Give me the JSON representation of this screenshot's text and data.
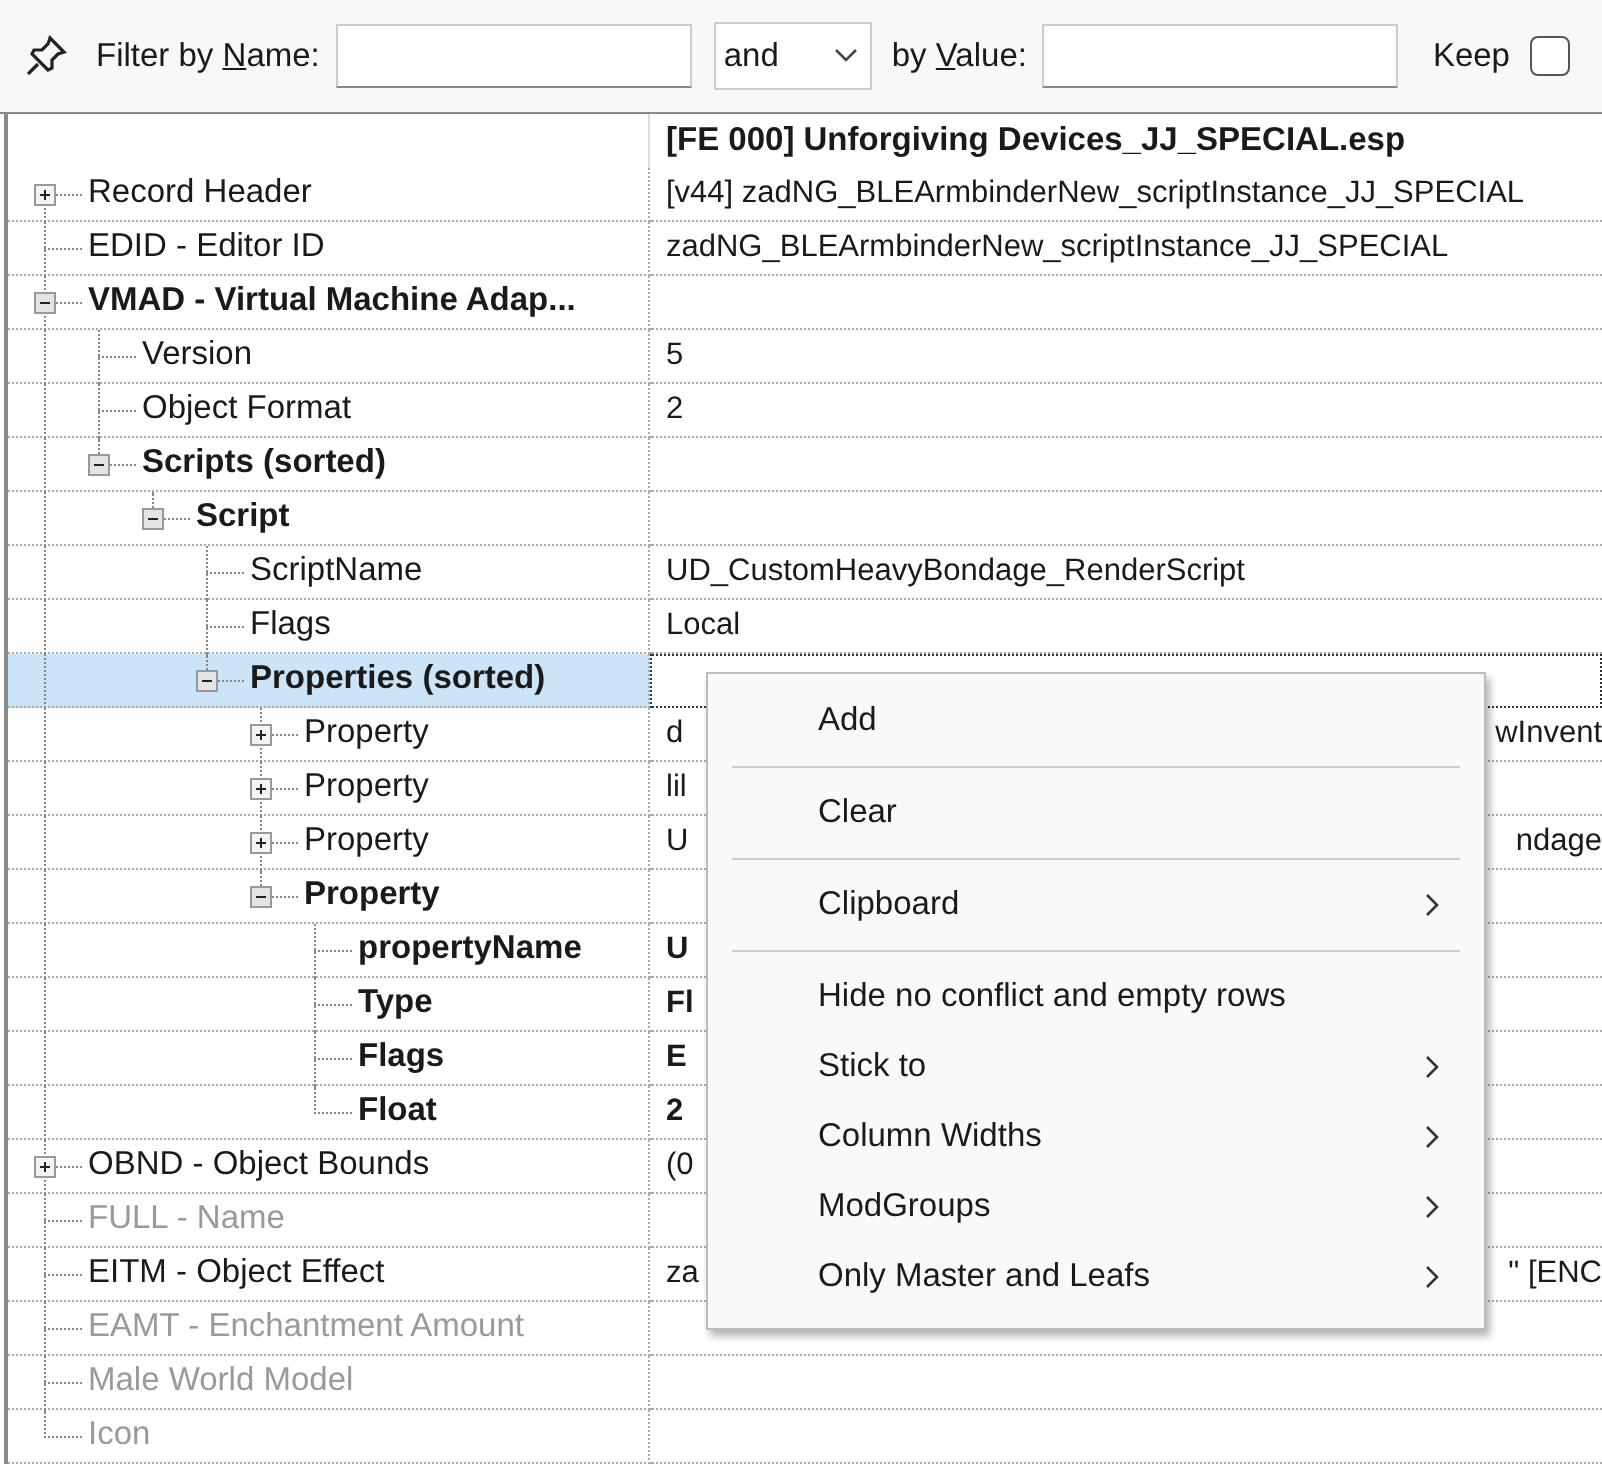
{
  "filter_bar": {
    "name_label": {
      "before": "Filter by ",
      "key": "N",
      "after": "ame:"
    },
    "operator": "and",
    "value_label": {
      "before": "by ",
      "key": "V",
      "after": "alue:"
    },
    "keep_label": "Keep",
    "keep_checked": false
  },
  "table": {
    "header": "[FE 000] Unforgiving Devices_JJ_SPECIAL.esp",
    "tree": [
      {
        "label": "Record Header",
        "value": "[v44] zadNG_BLEArmbinderNew_scriptInstance_JJ_SPECIAL",
        "kind": "branch",
        "expanded": false,
        "bold": false,
        "empty": false,
        "selected": false
      },
      {
        "label": "EDID - Editor ID",
        "value": "zadNG_BLEArmbinderNew_scriptInstance_JJ_SPECIAL",
        "kind": "leaf",
        "bold": false,
        "empty": false,
        "selected": false
      },
      {
        "label": "VMAD - Virtual Machine Adap...",
        "kind": "branch",
        "expanded": true,
        "bold": true,
        "empty": false,
        "selected": false,
        "children": [
          {
            "label": "Version",
            "value": "5",
            "kind": "leaf",
            "bold": false,
            "empty": false,
            "selected": false
          },
          {
            "label": "Object Format",
            "value": "2",
            "kind": "leaf",
            "bold": false,
            "empty": false,
            "selected": false
          },
          {
            "label": "Scripts (sorted)",
            "kind": "branch",
            "expanded": true,
            "bold": true,
            "empty": false,
            "selected": false,
            "children": [
              {
                "label": "Script",
                "kind": "branch",
                "expanded": true,
                "bold": true,
                "empty": false,
                "selected": false,
                "children": [
                  {
                    "label": "ScriptName",
                    "value": "UD_CustomHeavyBondage_RenderScript",
                    "kind": "leaf",
                    "bold": false,
                    "empty": false,
                    "selected": false
                  },
                  {
                    "label": "Flags",
                    "value": "Local",
                    "kind": "leaf",
                    "bold": false,
                    "empty": false,
                    "selected": false
                  },
                  {
                    "label": "Properties (sorted)",
                    "kind": "branch",
                    "expanded": true,
                    "bold": true,
                    "empty": false,
                    "selected": true,
                    "children": [
                      {
                        "label": "Property",
                        "value": "d",
                        "value_tail": "wInvent",
                        "kind": "branch",
                        "expanded": false,
                        "bold": false,
                        "empty": false,
                        "selected": false
                      },
                      {
                        "label": "Property",
                        "value": "lil",
                        "kind": "branch",
                        "expanded": false,
                        "bold": false,
                        "empty": false,
                        "selected": false
                      },
                      {
                        "label": "Property",
                        "value": "U",
                        "value_tail": "ndage",
                        "kind": "branch",
                        "expanded": false,
                        "bold": false,
                        "empty": false,
                        "selected": false
                      },
                      {
                        "label": "Property",
                        "kind": "branch",
                        "expanded": true,
                        "bold": true,
                        "empty": false,
                        "selected": false,
                        "children": [
                          {
                            "label": "propertyName",
                            "value": "U",
                            "kind": "leaf",
                            "bold": true,
                            "empty": false,
                            "selected": false
                          },
                          {
                            "label": "Type",
                            "value": "Fl",
                            "kind": "leaf",
                            "bold": true,
                            "empty": false,
                            "selected": false
                          },
                          {
                            "label": "Flags",
                            "value": "E",
                            "kind": "leaf",
                            "bold": true,
                            "empty": false,
                            "selected": false
                          },
                          {
                            "label": "Float",
                            "value": "2",
                            "kind": "leaf",
                            "bold": true,
                            "empty": false,
                            "selected": false
                          }
                        ]
                      }
                    ]
                  }
                ]
              }
            ]
          }
        ]
      },
      {
        "label": "OBND - Object Bounds",
        "value": "(0",
        "kind": "branch",
        "expanded": false,
        "bold": false,
        "empty": false,
        "selected": false
      },
      {
        "label": "FULL - Name",
        "kind": "leaf",
        "bold": false,
        "empty": true,
        "selected": false
      },
      {
        "label": "EITM - Object Effect",
        "value": "za",
        "value_tail": "\" [ENC",
        "kind": "leaf",
        "bold": false,
        "empty": false,
        "selected": false
      },
      {
        "label": "EAMT - Enchantment Amount",
        "kind": "leaf",
        "bold": false,
        "empty": true,
        "selected": false
      },
      {
        "label": "Male World Model",
        "kind": "leaf",
        "bold": false,
        "empty": true,
        "selected": false
      },
      {
        "label": "Icon",
        "kind": "leaf",
        "bold": false,
        "empty": true,
        "selected": false
      }
    ]
  },
  "context_menu": [
    {
      "kind": "item",
      "label": "Add",
      "submenu": false
    },
    {
      "kind": "separator"
    },
    {
      "kind": "item",
      "label": "Clear",
      "submenu": false
    },
    {
      "kind": "separator"
    },
    {
      "kind": "item",
      "label": "Clipboard",
      "submenu": true
    },
    {
      "kind": "separator"
    },
    {
      "kind": "item",
      "label": "Hide no conflict and empty rows",
      "submenu": false
    },
    {
      "kind": "item",
      "label": "Stick to",
      "submenu": true
    },
    {
      "kind": "item",
      "label": "Column Widths",
      "submenu": true
    },
    {
      "kind": "item",
      "label": "ModGroups",
      "submenu": true
    },
    {
      "kind": "item",
      "label": "Only Master and Leafs",
      "submenu": true
    }
  ]
}
